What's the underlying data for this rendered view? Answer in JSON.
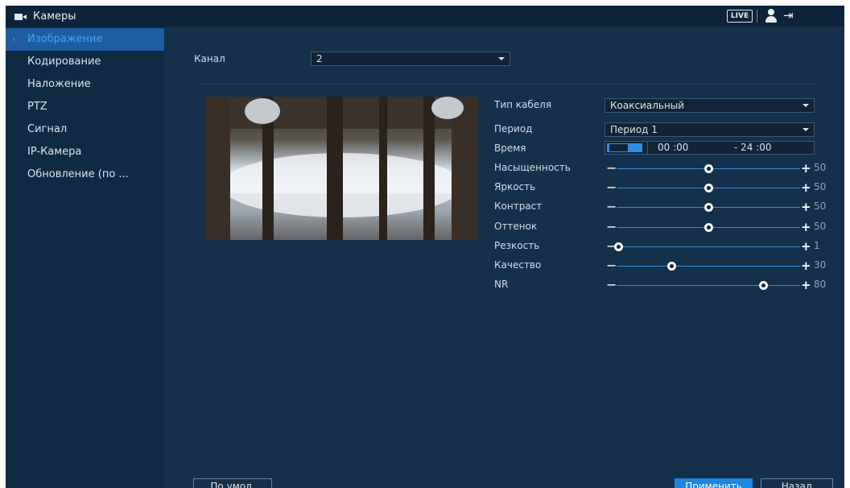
{
  "header": {
    "title": "Камеры",
    "live_label": "LIVE"
  },
  "sidebar": {
    "items": [
      {
        "label": "Изображение",
        "active": true
      },
      {
        "label": "Кодирование"
      },
      {
        "label": "Наложение"
      },
      {
        "label": "PTZ"
      },
      {
        "label": "Сигнал"
      },
      {
        "label": "IP-Камера"
      },
      {
        "label": "Обновление (по ..."
      }
    ]
  },
  "channel": {
    "label": "Канал",
    "value": "2"
  },
  "settings": {
    "cable_type": {
      "label": "Тип кабеля",
      "value": "Коаксиальный"
    },
    "period": {
      "label": "Период",
      "value": "Период 1"
    },
    "time": {
      "label": "Время",
      "start": "00 :00",
      "end": "- 24 :00"
    },
    "sliders": [
      {
        "label": "Насыщенность",
        "value": 50
      },
      {
        "label": "Яркость",
        "value": 50
      },
      {
        "label": "Контраст",
        "value": 50
      },
      {
        "label": "Оттенок",
        "value": 50
      },
      {
        "label": "Резкость",
        "value": 1
      },
      {
        "label": "Качество",
        "value": 30
      },
      {
        "label": "NR",
        "value": 80
      }
    ]
  },
  "buttons": {
    "default": "По умол.",
    "apply": "Применить",
    "back": "Назад"
  },
  "colors": {
    "accent": "#2e8ee3",
    "sidebar_active": "#1e5ea0",
    "background": "#15304b"
  },
  "icons": {
    "camera": "camera-icon",
    "user": "user-icon",
    "logout": "logout-icon"
  }
}
